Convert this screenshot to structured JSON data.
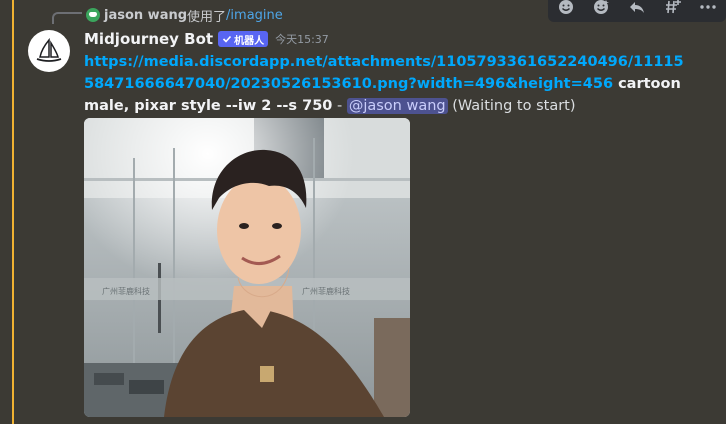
{
  "reply": {
    "username": "jason wang",
    "action": "使用了",
    "command": "/imagine"
  },
  "message": {
    "author": "Midjourney Bot",
    "bot_tag": "机器人",
    "timestamp": "今天15:37",
    "link": "https://media.discordapp.net/attachments/1105793361652240496/1111558471666647040/20230526153610.png?width=496&height=456",
    "prompt": " cartoon male, pixar style --iw 2 --s 750",
    "separator": " - ",
    "mention": "@jason wang",
    "status": " (Waiting to start)"
  },
  "toolbar": {
    "icons": [
      "add-reaction-icon",
      "super-reaction-icon",
      "reply-icon",
      "create-thread-icon",
      "more-icon"
    ]
  },
  "image": {
    "glass_text_left": "广州菲鹿科技",
    "glass_text_right": "广州菲鹿科技"
  },
  "colors": {
    "background": "#3c3a34",
    "accent_bar": "#f0b232",
    "link": "#00a8fc",
    "bot_tag": "#5865f2",
    "mention_bg": "#4d5290",
    "reply_command": "#4ea6e8"
  }
}
